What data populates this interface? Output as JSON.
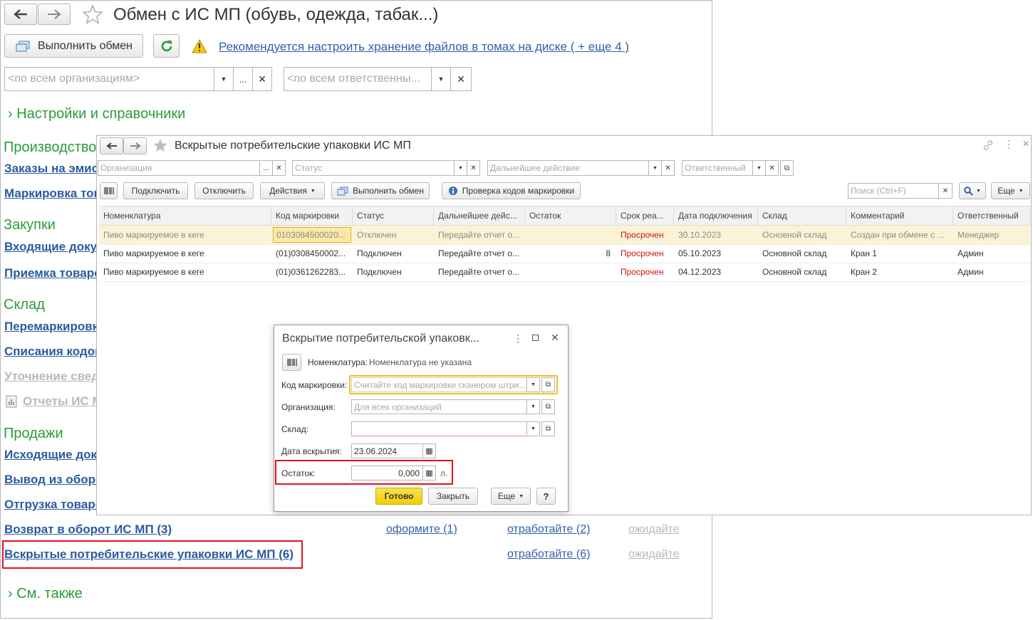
{
  "back": {
    "title": "Обмен с ИС МП (обувь, одежда, табак...)",
    "exchange_btn": "Выполнить обмен",
    "warning_link": "Рекомендуется настроить хранение файлов в томах на диске ( + еще 4 )",
    "org_placeholder": "<по всем организациям>",
    "resp_placeholder": "<по всем ответственны...",
    "dots": "...",
    "settings_group": "Настройки и справочники",
    "groups": {
      "production": "Производство",
      "purchases": "Закупки",
      "warehouse": "Склад",
      "sales": "Продажи",
      "see_also": "См. также"
    },
    "links": {
      "orders": "Заказы на эмиссию",
      "marking": "Маркировка товаров",
      "incoming": "Входящие документы",
      "acceptance": "Приемка товаров",
      "remarking": "Перемаркировка",
      "writeoff": "Списания кодов",
      "clarify": "Уточнение сведений",
      "reports": "Отчеты ИС МП",
      "outgoing": "Исходящие документы",
      "withdraw": "Вывод из оборота",
      "shipment": "Отгрузка товаров",
      "return": "Возврат в оборот ИС МП (3)",
      "opened": "Вскрытые потребительские упаковки ИС МП (6)"
    },
    "row_return": {
      "a": "оформите (1)",
      "b": "отработайте (2)",
      "c": "ожидайте"
    },
    "row_opened": {
      "b": "отработайте (6)",
      "c": "ожидайте"
    }
  },
  "mid": {
    "title": "Вскрытые потребительские упаковки ИС МП",
    "filters": {
      "org": "Организация",
      "status": "Статус",
      "next": "Дальнейшее действие",
      "resp": "Ответственный"
    },
    "toolbar": {
      "connect": "Подключить",
      "disconnect": "Отключить",
      "actions": "Действия",
      "exchange": "Выполнить обмен",
      "check": "Проверка кодов маркировки",
      "search": "Поиск (Ctrl+F)",
      "more": "Еще"
    },
    "columns": [
      "Номенклатура",
      "Код маркировки",
      "Статус",
      "Дальнейшее дейс...",
      "Остаток",
      "Срок реа...",
      "Дата подключения",
      "Склад",
      "Комментарий",
      "Ответственный"
    ],
    "rows": [
      {
        "nom": "Пиво маркируемое в кеге",
        "code": "0103084500020...",
        "status": "Отключен",
        "next": "Передайте отчет о...",
        "rest": "",
        "term": "Просрочен",
        "date": "30.10.2023",
        "store": "Основной склад",
        "comment": "Создан при обмене с ...",
        "resp": "Менеджер"
      },
      {
        "nom": "Пиво маркируемое в кеге",
        "code": "(01)0308450002...",
        "status": "Подключен",
        "next": "Передайте отчет о...",
        "rest": "8",
        "term": "Просрочен",
        "date": "05.10.2023",
        "store": "Основной склад",
        "comment": "Кран 1",
        "resp": "Админ"
      },
      {
        "nom": "Пиво маркируемое в кеге",
        "code": "(01)0361262283...",
        "status": "Подключен",
        "next": "Передайте отчет о...",
        "rest": "",
        "term": "Просрочен",
        "date": "04.12.2023",
        "store": "Основной склад",
        "comment": "Кран 2",
        "resp": "Админ"
      }
    ]
  },
  "dlg": {
    "title": "Вскрытие потребительской упаковк...",
    "nom_label": "Номенклатура:",
    "nom_value": "Номенклатура не указана",
    "code_label": "Код маркировки:",
    "code_placeholder": "Считайте код маркировки сканером штри...",
    "org_label": "Организация:",
    "org_placeholder": "Для всех организаций",
    "store_label": "Склад:",
    "date_label": "Дата вскрытия:",
    "date_value": "23.06.2024",
    "rest_label": "Остаток:",
    "rest_value": "0,000",
    "unit": "л.",
    "ok": "Готово",
    "close": "Закрыть",
    "more": "Еще",
    "help": "?"
  },
  "colors": {
    "green": "#2a9d3a",
    "link": "#2a5b9f",
    "highlight": "#e0141e",
    "yellow": "#f6d814",
    "expired": "#d01010"
  }
}
